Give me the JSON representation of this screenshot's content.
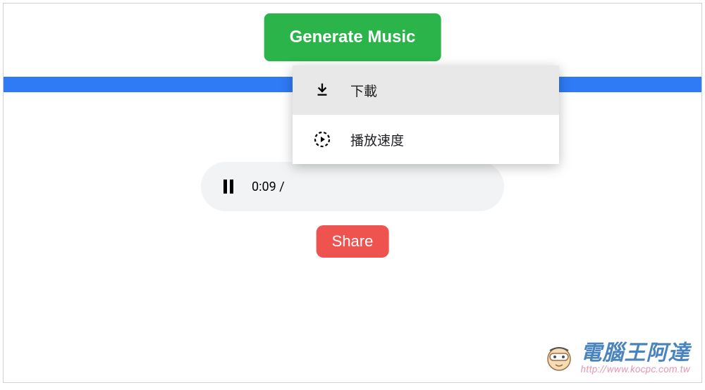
{
  "generate_button_label": "Generate Music",
  "player": {
    "current_time": "0:09",
    "separator": "/"
  },
  "share_button_label": "Share",
  "context_menu": {
    "items": [
      {
        "icon": "download-icon",
        "label": "下載",
        "hover": true
      },
      {
        "icon": "playback-speed-icon",
        "label": "播放速度",
        "hover": false
      }
    ]
  },
  "watermark": {
    "title": "電腦王阿達",
    "url": "http://www.kocpc.com.tw"
  },
  "colors": {
    "green": "#2bb44a",
    "blue": "#2f7af5",
    "red": "#ef5350"
  }
}
